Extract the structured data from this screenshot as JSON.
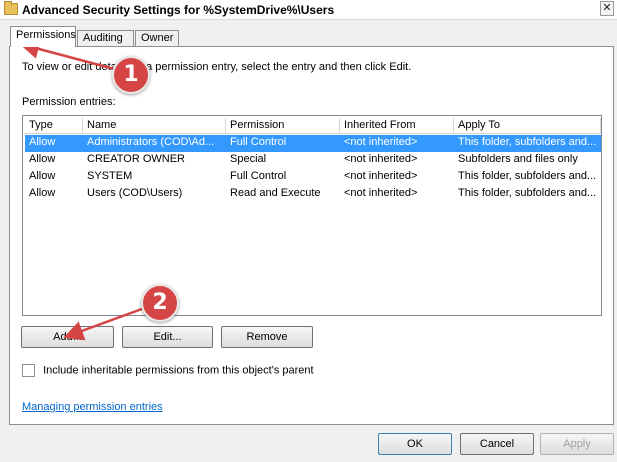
{
  "window": {
    "title": "Advanced Security Settings for %SystemDrive%\\Users",
    "close_glyph": "✕"
  },
  "tabs": [
    {
      "label": "Permissions",
      "active": true
    },
    {
      "label": "Auditing",
      "active": false
    },
    {
      "label": "Owner",
      "active": false
    }
  ],
  "permissions": {
    "info_text": "To view or edit details for a permission entry, select the entry and then click Edit.",
    "entries_label": "Permission entries:",
    "columns": [
      "Type",
      "Name",
      "Permission",
      "Inherited From",
      "Apply To"
    ],
    "rows": [
      {
        "type": "Allow",
        "name": "Administrators (COD\\Ad...",
        "permission": "Full Control",
        "inherited_from": "<not inherited>",
        "apply_to": "This folder, subfolders and...",
        "selected": true
      },
      {
        "type": "Allow",
        "name": "CREATOR OWNER",
        "permission": "Special",
        "inherited_from": "<not inherited>",
        "apply_to": "Subfolders and files only",
        "selected": false
      },
      {
        "type": "Allow",
        "name": "SYSTEM",
        "permission": "Full Control",
        "inherited_from": "<not inherited>",
        "apply_to": "This folder, subfolders and...",
        "selected": false
      },
      {
        "type": "Allow",
        "name": "Users (COD\\Users)",
        "permission": "Read and Execute",
        "inherited_from": "<not inherited>",
        "apply_to": "This folder, subfolders and...",
        "selected": false
      }
    ],
    "add_label": "Add...",
    "edit_label": "Edit...",
    "remove_label": "Remove",
    "include_inheritable_label": "Include inheritable permissions from this object's parent",
    "include_inheritable_checked": false,
    "manage_link": "Managing permission entries"
  },
  "footer": {
    "ok_label": "OK",
    "cancel_label": "Cancel",
    "apply_label": "Apply",
    "apply_enabled": false
  },
  "annotations": {
    "badge1": "1",
    "badge2": "2",
    "color": "#d64545"
  },
  "colors": {
    "selection": "#3399ff",
    "link": "#0066cc"
  }
}
